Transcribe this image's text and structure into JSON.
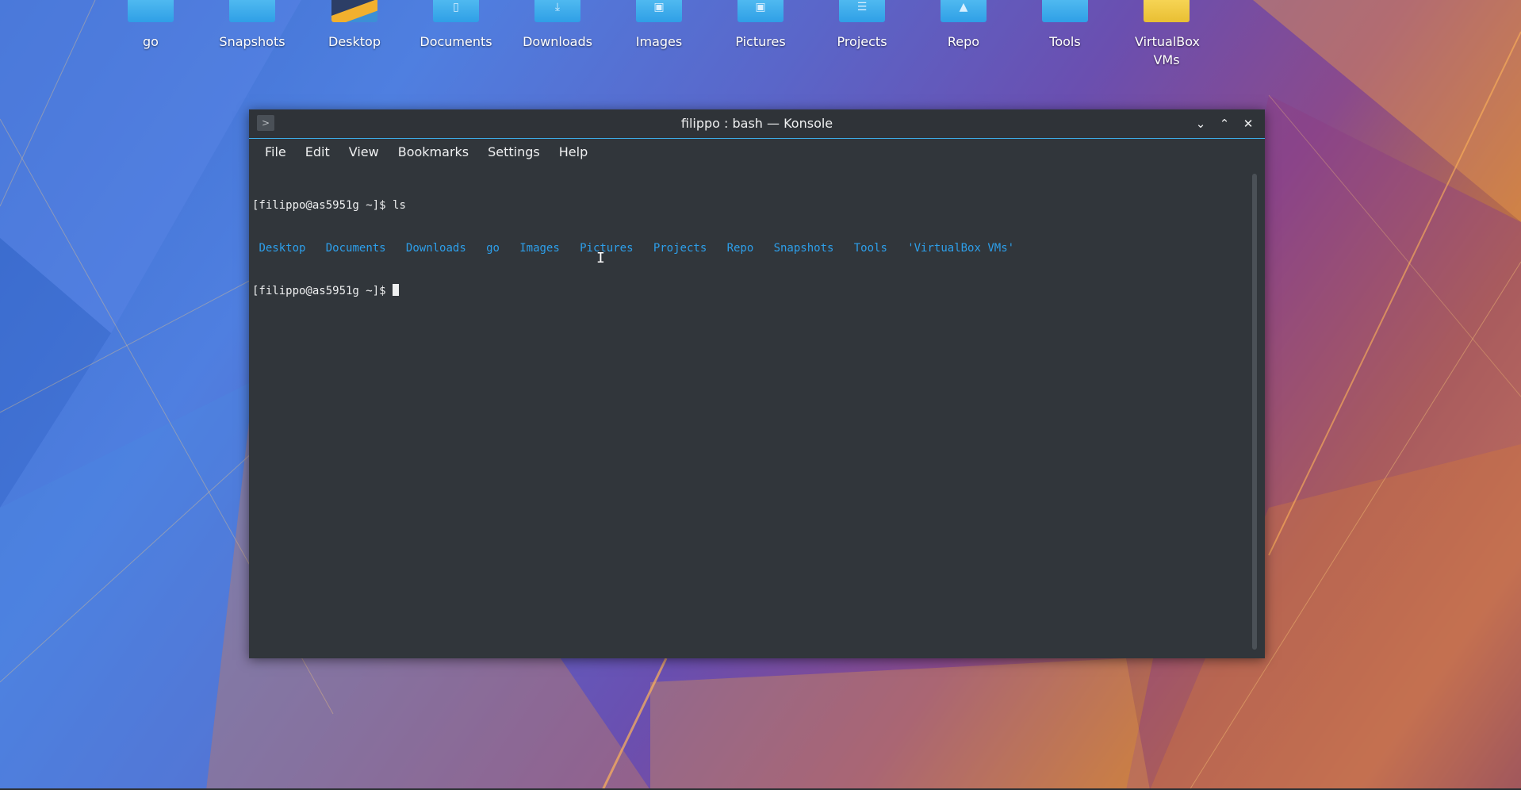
{
  "desktop": {
    "icons": [
      {
        "label": "go",
        "color": "#3daee9",
        "glyph": ""
      },
      {
        "label": "Snapshots",
        "color": "#3daee9",
        "glyph": ""
      },
      {
        "label": "Desktop",
        "color": "#2c3e66",
        "glyph": ""
      },
      {
        "label": "Documents",
        "color": "#3daee9",
        "glyph": "▯"
      },
      {
        "label": "Downloads",
        "color": "#3daee9",
        "glyph": "⤓"
      },
      {
        "label": "Images",
        "color": "#3daee9",
        "glyph": "▣"
      },
      {
        "label": "Pictures",
        "color": "#3daee9",
        "glyph": "▣"
      },
      {
        "label": "Projects",
        "color": "#3daee9",
        "glyph": "☰"
      },
      {
        "label": "Repo",
        "color": "#3daee9",
        "glyph": "▲"
      },
      {
        "label": "Tools",
        "color": "#3daee9",
        "glyph": ""
      },
      {
        "label": "VirtualBox VMs",
        "color": "#f0c93e",
        "glyph": ""
      }
    ]
  },
  "window": {
    "title": "filippo : bash — Konsole",
    "app_icon": "terminal-icon",
    "controls": {
      "minimize": "minimize-icon",
      "maximize": "maximize-icon",
      "close": "close-icon"
    },
    "accent": "#3daee9"
  },
  "menubar": {
    "file": "File",
    "edit": "Edit",
    "view": "View",
    "bookmarks": "Bookmarks",
    "settings": "Settings",
    "help": "Help"
  },
  "terminal": {
    "prompt": "[filippo@as5951g ~]$ ",
    "command": "ls",
    "entries": [
      "Desktop",
      "Documents",
      "Downloads",
      "go",
      "Images",
      "Pictures",
      "Projects",
      "Repo",
      "Snapshots",
      "Tools",
      "'VirtualBox VMs'"
    ],
    "dir_color": "#2d9fea"
  }
}
